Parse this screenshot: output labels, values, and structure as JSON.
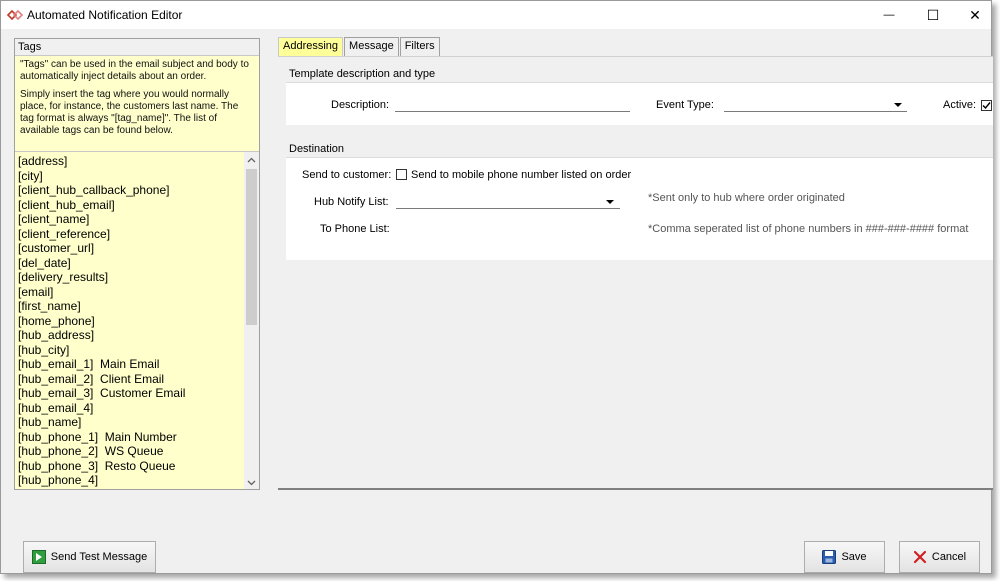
{
  "window": {
    "title": "Automated Notification Editor",
    "minimize_glyph": "—",
    "maximize_glyph": "☐",
    "close_glyph": "✕"
  },
  "tags_panel": {
    "header": "Tags",
    "desc_p1": "\"Tags\" can be used in the email subject and body to automatically inject details about an order.",
    "desc_p2": "Simply insert the tag where you would normally place, for instance, the customers last name.  The tag format is always \"[tag_name]\".  The list of available tags can be found below.",
    "items": [
      "[address]",
      "[city]",
      "[client_hub_callback_phone]",
      "[client_hub_email]",
      "[client_name]",
      "[client_reference]",
      "[customer_url]",
      "[del_date]",
      "[delivery_results]",
      "[email]",
      "[first_name]",
      "[home_phone]",
      "[hub_address]",
      "[hub_city]",
      "[hub_email_1]  Main Email",
      "[hub_email_2]  Client Email",
      "[hub_email_3]  Customer Email",
      "[hub_email_4]",
      "[hub_name]",
      "[hub_phone_1]  Main Number",
      "[hub_phone_2]  WS Queue",
      "[hub_phone_3]  Resto Queue",
      "[hub_phone_4]"
    ]
  },
  "tabs": [
    {
      "label": "Addressing",
      "active": true
    },
    {
      "label": "Message",
      "active": false
    },
    {
      "label": "Filters",
      "active": false
    }
  ],
  "template_section": {
    "header": "Template description and type",
    "description_label": "Description:",
    "description_value": "",
    "event_type_label": "Event Type:",
    "event_type_value": "",
    "active_label": "Active:",
    "active_checked": true
  },
  "destination_section": {
    "header": "Destination",
    "send_to_customer_label": "Send to customer:",
    "send_mobile_label": "Send to mobile phone number listed on order",
    "send_mobile_checked": false,
    "hub_notify_label": "Hub Notify List:",
    "hub_notify_value": "",
    "hub_notify_note": "*Sent only to hub where order originated",
    "to_phone_label": "To Phone List:",
    "to_phone_value": "",
    "to_phone_note": "*Comma seperated list of phone numbers in ###-###-#### format"
  },
  "buttons": {
    "send_test": "Send Test Message",
    "save": "Save",
    "cancel": "Cancel"
  },
  "colors": {
    "tags_background": "#ffffcc",
    "active_tab": "#ffff99",
    "save_icon": "#2a5db0",
    "cancel_icon": "#d02020",
    "send_icon": "#2e9e3e"
  }
}
